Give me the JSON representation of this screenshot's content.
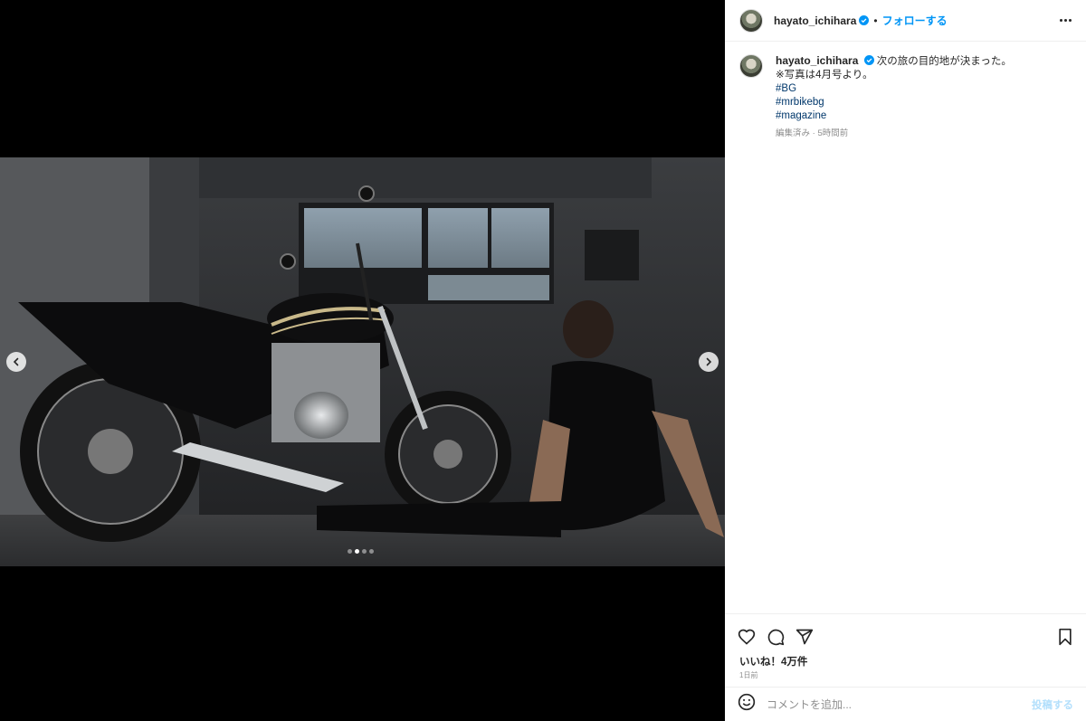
{
  "post": {
    "username": "hayato_ichihara",
    "follow_label": "フォローする",
    "separator": "•",
    "verified": true
  },
  "caption": {
    "username": "hayato_ichihara",
    "line1": "次の旅の目的地が決まった。",
    "line2": "※写真は4月号より。",
    "hashtags": [
      "#BG",
      "#mrbikebg",
      "#magazine"
    ],
    "meta": "編集済み · 5時間前"
  },
  "media": {
    "description_icons": [
      "chevron-left-icon",
      "chevron-right-icon"
    ],
    "dots_total": 4,
    "active_dot_index": 1
  },
  "engagement": {
    "likes": "いいね！4万件",
    "date": "1日前"
  },
  "comment_box": {
    "placeholder": "コメントを追加...",
    "post_label": "投稿する"
  },
  "colors": {
    "accent": "#0095f6",
    "text": "#262626",
    "muted": "#8e8e8e",
    "hashtag": "#00376b",
    "verified": "#0095f6"
  }
}
